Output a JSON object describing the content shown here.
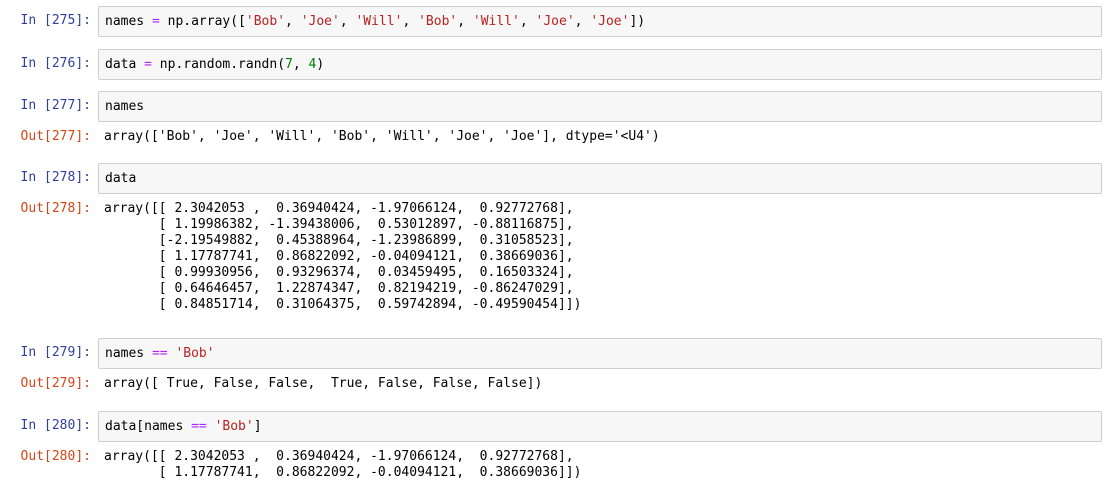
{
  "colors": {
    "in_prompt": "#303f9f",
    "out_prompt": "#d84315",
    "string": "#ba2121",
    "operator": "#aa22ff",
    "number": "#008000",
    "input_bg": "#f7f7f7",
    "input_border": "#cfcfcf"
  },
  "cells": [
    {
      "in_prompt": "In [275]:",
      "input_tokens": [
        "names ",
        "=",
        " np.array([",
        "'Bob'",
        ", ",
        "'Joe'",
        ", ",
        "'Will'",
        ", ",
        "'Bob'",
        ", ",
        "'Will'",
        ", ",
        "'Joe'",
        ", ",
        "'Joe'",
        "])"
      ]
    },
    {
      "in_prompt": "In [276]:",
      "input_tokens": [
        "data ",
        "=",
        " np.random.randn(",
        "7",
        ", ",
        "4",
        ")"
      ]
    },
    {
      "in_prompt": "In [277]:",
      "input_tokens": [
        "names"
      ],
      "out_prompt": "Out[277]:",
      "output": "array(['Bob', 'Joe', 'Will', 'Bob', 'Will', 'Joe', 'Joe'], dtype='<U4')"
    },
    {
      "in_prompt": "In [278]:",
      "input_tokens": [
        "data"
      ],
      "out_prompt": "Out[278]:",
      "output": "array([[ 2.3042053 ,  0.36940424, -1.97066124,  0.92772768],\n       [ 1.19986382, -1.39438006,  0.53012897, -0.88116875],\n       [-2.19549882,  0.45388964, -1.23986899,  0.31058523],\n       [ 1.17787741,  0.86822092, -0.04094121,  0.38669036],\n       [ 0.99930956,  0.93296374,  0.03459495,  0.16503324],\n       [ 0.64646457,  1.22874347,  0.82194219, -0.86247029],\n       [ 0.84851714,  0.31064375,  0.59742894, -0.49590454]])"
    },
    {
      "in_prompt": "In [279]:",
      "input_tokens": [
        "names ",
        "==",
        " ",
        "'Bob'"
      ],
      "out_prompt": "Out[279]:",
      "output": "array([ True, False, False,  True, False, False, False])"
    },
    {
      "in_prompt": "In [280]:",
      "input_tokens": [
        "data[names ",
        "==",
        " ",
        "'Bob'",
        "]"
      ],
      "out_prompt": "Out[280]:",
      "output": "array([[ 2.3042053 ,  0.36940424, -1.97066124,  0.92772768],\n       [ 1.17787741,  0.86822092, -0.04094121,  0.38669036]])"
    }
  ]
}
